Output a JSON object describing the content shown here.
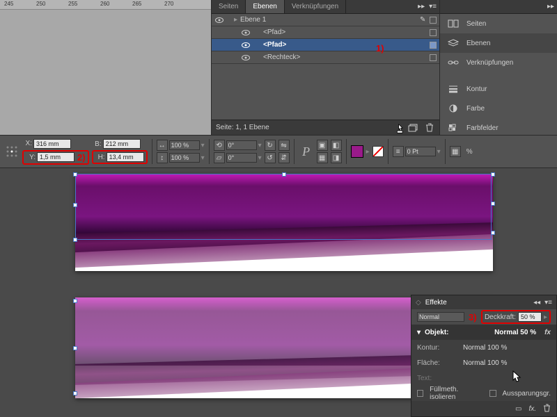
{
  "ruler": {
    "ticks": [
      "245",
      "250",
      "255",
      "260",
      "265",
      "270"
    ]
  },
  "tabs": {
    "seiten": "Seiten",
    "ebenen": "Ebenen",
    "verkn": "Verknüpfungen"
  },
  "layers": {
    "top": "Ebene 1",
    "items": [
      "<Pfad>",
      "<Pfad>",
      "<Rechteck>"
    ]
  },
  "status": "Seite: 1, 1 Ebene",
  "side": {
    "seiten": "Seiten",
    "ebenen": "Ebenen",
    "verkn": "Verknüpfungen",
    "kontur": "Kontur",
    "farbe": "Farbe",
    "farbfelder": "Farbfelder"
  },
  "ctrl": {
    "x": "316 mm",
    "y": "1,5 mm",
    "b": "212 mm",
    "h": "13,4 mm",
    "sx": "100 %",
    "sy": "100 %",
    "rot": "0°",
    "shear": "0°",
    "stroke": "0 Pt",
    "a1": "1)",
    "a2": "2)",
    "a3": "3)"
  },
  "fx": {
    "title": "Effekte",
    "mode": "Normal",
    "opacityLabel": "Deckkraft:",
    "opacity": "50 %",
    "objekt": "Objekt:",
    "objval": "Normal 50 %",
    "kontur": "Kontur:",
    "konturval": "Normal 100 %",
    "flaeche": "Fläche:",
    "flaecheval": "Normal 100 %",
    "text": "Text:",
    "fuell": "Füllmeth. isolieren",
    "auss": "Aussparungsgr.",
    "fxbtn": "fx."
  }
}
